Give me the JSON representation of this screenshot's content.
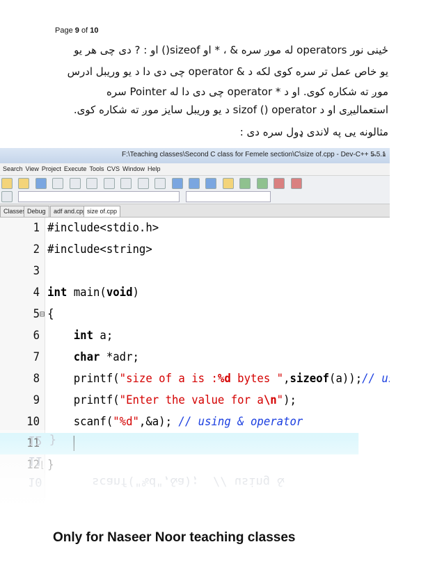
{
  "page": {
    "label": "Page",
    "current": "9",
    "of": "of",
    "total": "10"
  },
  "intro": {
    "line1": "ځینی نور operators له موږ سره & ، * او sizeof() او : ? دی چی هر یو",
    "line2": "یو خاص عمل تر سره کوی لکه د & operator چی دی دا د یو وریبل ادرس",
    "line3": "موږ ته شکاره کوی. او د * operator چی دی دا له Pointer سره",
    "line4": "استعمالیږی او د sizof () operator د یو وریبل سایز موږ ته شکاره کوی.",
    "line5": "مثالونه یی په لاندی ډول سره دی :"
  },
  "ide": {
    "title": "F:\\Teaching classes\\Second C class for Femele section\\C\\size of.cpp - Dev-C++ 5.5.1",
    "menu": [
      "Search",
      "View",
      "Project",
      "Execute",
      "Tools",
      "CVS",
      "Window",
      "Help"
    ],
    "left_tabs": [
      "Classes",
      "Debug"
    ],
    "file_tabs": [
      "adf and.cpp",
      "size of.cpp"
    ],
    "lines": [
      {
        "n": "1",
        "tokens": [
          {
            "t": "#include<stdio.h>",
            "c": "pp"
          }
        ]
      },
      {
        "n": "2",
        "tokens": [
          {
            "t": "#include<string>",
            "c": "pp"
          }
        ]
      },
      {
        "n": "3",
        "tokens": []
      },
      {
        "n": "4",
        "tokens": [
          {
            "t": "int",
            "c": "kw"
          },
          {
            "t": " main(",
            "c": ""
          },
          {
            "t": "void",
            "c": "kw"
          },
          {
            "t": ")",
            "c": ""
          }
        ]
      },
      {
        "n": "5",
        "fold": "⊟",
        "tokens": [
          {
            "t": "{",
            "c": ""
          }
        ]
      },
      {
        "n": "6",
        "tokens": [
          {
            "t": "    ",
            "c": ""
          },
          {
            "t": "int",
            "c": "kw"
          },
          {
            "t": " a;",
            "c": ""
          }
        ]
      },
      {
        "n": "7",
        "tokens": [
          {
            "t": "    ",
            "c": ""
          },
          {
            "t": "char",
            "c": "kw"
          },
          {
            "t": " *adr;",
            "c": ""
          }
        ]
      },
      {
        "n": "8",
        "tokens": [
          {
            "t": "    printf(",
            "c": ""
          },
          {
            "t": "\"size of a is :",
            "c": "str"
          },
          {
            "t": "%d",
            "c": "esc"
          },
          {
            "t": " bytes \"",
            "c": "str"
          },
          {
            "t": ",",
            "c": ""
          },
          {
            "t": "sizeof",
            "c": "kw"
          },
          {
            "t": "(a));",
            "c": ""
          },
          {
            "t": "// using size of",
            "c": "cmt"
          }
        ]
      },
      {
        "n": "9",
        "tokens": [
          {
            "t": "    printf(",
            "c": ""
          },
          {
            "t": "\"Enter the value for a",
            "c": "str"
          },
          {
            "t": "\\n",
            "c": "esc"
          },
          {
            "t": "\"",
            "c": "str"
          },
          {
            "t": ");",
            "c": ""
          }
        ]
      },
      {
        "n": "10",
        "tokens": [
          {
            "t": "    scanf(",
            "c": ""
          },
          {
            "t": "\"%d\"",
            "c": "str"
          },
          {
            "t": ",&a); ",
            "c": ""
          },
          {
            "t": "// using & operator",
            "c": "cmt"
          }
        ]
      },
      {
        "n": "11",
        "highlight": true,
        "cursor": true,
        "tokens": [
          {
            "t": "    ",
            "c": ""
          }
        ]
      },
      {
        "n": "12",
        "fold": "⌊",
        "tokens": [
          {
            "t": "}",
            "c": ""
          }
        ]
      }
    ],
    "reflection": [
      "12 }",
      "11",
      "10       scanf(\"%d\",&a);  // using &"
    ]
  },
  "footer": {
    "text": "Only for Naseer Noor teaching classes"
  }
}
